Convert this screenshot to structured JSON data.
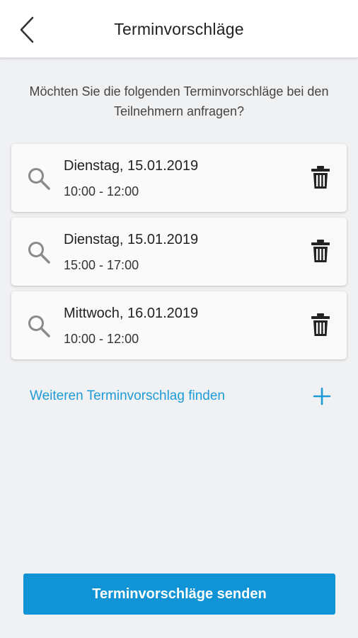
{
  "header": {
    "title": "Terminvorschläge",
    "back_icon": "chevron-left-icon"
  },
  "intro": {
    "text": "Möchten Sie die folgenden Terminvorschläge bei den Teilnehmern anfragen?"
  },
  "proposals": [
    {
      "date": "Dienstag, 15.01.2019",
      "time": "10:00 - 12:00"
    },
    {
      "date": "Dienstag, 15.01.2019",
      "time": "15:00 - 17:00"
    },
    {
      "date": "Mittwoch, 16.01.2019",
      "time": "10:00 - 12:00"
    }
  ],
  "add": {
    "label": "Weiteren Terminvorschlag finden",
    "icon": "plus-icon"
  },
  "send_button": {
    "label": "Terminvorschläge senden"
  },
  "colors": {
    "accent": "#1e9bd7",
    "button": "#1194d6",
    "background": "#f0f1f3",
    "card": "#fafafb"
  }
}
